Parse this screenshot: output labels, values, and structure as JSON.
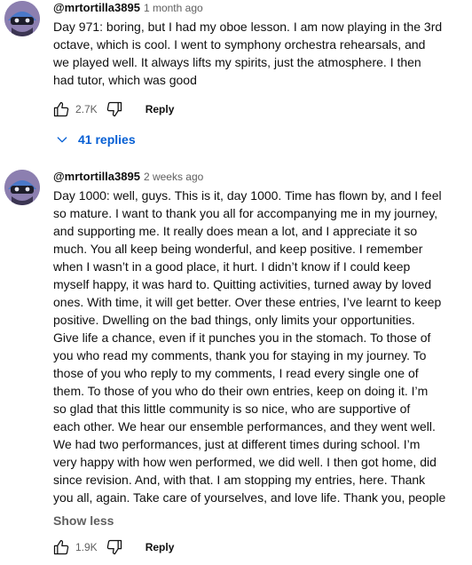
{
  "comments": [
    {
      "author": "@mrtortilla3895",
      "time": "1 month ago",
      "lines": [
        "Day 971: boring, but I had my oboe lesson. I am now playing in the 3rd",
        "octave, which is cool.  I went to symphony orchestra rehearsals, and",
        "we played well. It always lifts my spirits, just the atmosphere. I then",
        "had tutor, which was good"
      ],
      "likes": "2.7K",
      "reply_label": "Reply",
      "replies_label": "41 replies"
    },
    {
      "author": "@mrtortilla3895",
      "time": "2 weeks ago",
      "lines": [
        "Day 1000: well, guys. This is it, day 1000. Time has flown by, and I feel",
        "so mature. I want to thank you all for accompanying me in my journey,",
        "and supporting me. It really does mean a lot, and I appreciate it so",
        "much. You all keep being wonderful, and keep positive. I remember",
        "when I wasn’t in a good place, it hurt. I didn’t know if I could keep",
        "myself happy, it was hard to. Quitting activities, turned away by loved",
        "ones. With time, it will get better. Over these entries, I’ve learnt to keep",
        "positive. Dwelling on the bad things, only limits your opportunities.",
        "Give life a chance, even if it punches you in the stomach. To those of",
        "you who read my comments, thank you for staying in my journey. To",
        "those of you who reply to my comments, I read every single one of",
        "them. To those of you who do their own entries, keep on doing it. I’m",
        "so glad that this little community is so nice, who are supportive of",
        "each other. We hear our ensemble performances, and they went well.",
        "We had two performances, just at different times during school. I’m",
        "very happy with how wen performed, we did well. I then got home, did",
        "since revision. And, with that. I am stopping my entries, here. Thank",
        "you all, again. Take care of yourselves, and love life. Thank you, people"
      ],
      "show_less_label": "Show less",
      "likes": "1.9K",
      "reply_label": "Reply"
    }
  ],
  "colors": {
    "link_blue": "#065fd4",
    "meta_gray": "#606060",
    "text": "#0f0f0f"
  }
}
